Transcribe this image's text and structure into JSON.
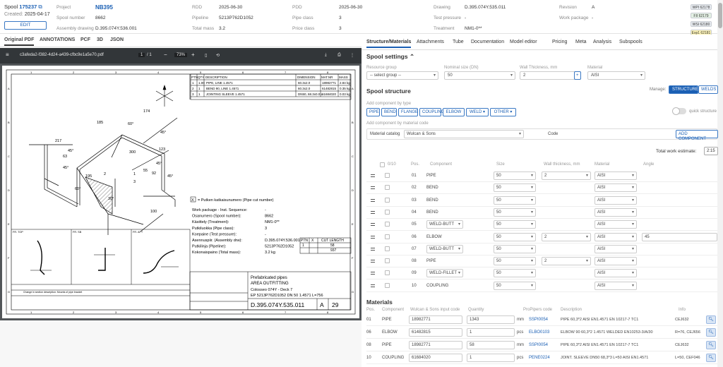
{
  "header": {
    "spool_label": "Spool",
    "spool_id": "175237",
    "created_label": "Created:",
    "created": "2025-04-17",
    "edit": "EDIT",
    "fields": [
      {
        "k": "Project",
        "v": "NB395"
      },
      {
        "k": "Spool number",
        "v": "8662"
      },
      {
        "k": "Assembly drawing",
        "v": "D.395.074Y.536.001"
      },
      {
        "k": "RDD",
        "v": "2025-06-30"
      },
      {
        "k": "Pipeline",
        "v": "5213P762D1052"
      },
      {
        "k": "Total mass",
        "v": "3.2"
      },
      {
        "k": "PDD",
        "v": "2025-06-30"
      },
      {
        "k": "Pipe class",
        "v": "3"
      },
      {
        "k": "Price class",
        "v": "3"
      },
      {
        "k": "Drawing",
        "v": "D.395.074Y.535.011"
      },
      {
        "k": "Test pressure",
        "v": "-"
      },
      {
        "k": "Treatment",
        "v": "NM1-0**"
      },
      {
        "k": "Revision",
        "v": "A"
      },
      {
        "k": "Work package",
        "v": "-"
      }
    ],
    "badges": [
      {
        "t": "WPI 62178",
        "c": "#e9edf2"
      },
      {
        "t": "FII 62179",
        "c": "#e3f0e3"
      },
      {
        "t": "WSI 62180",
        "c": "#e9edf2"
      },
      {
        "t": "Exp1 62181",
        "c": "#fff5b8"
      }
    ]
  },
  "left_tabs": [
    "Original PDF",
    "ANNOTATIONS",
    "PCF",
    "3D",
    "JSON"
  ],
  "pdf": {
    "filename": "c3afeda2-f382-4d24-a439-cfbc9e1a5e70.pdf",
    "page": "1",
    "pages": "/  1",
    "zoom": "73%"
  },
  "drawing": {
    "bom_headers": [
      "PTN",
      "QTY",
      "DESCRIPTION",
      "DIMENSION",
      "MAT.NR",
      "MASS"
    ],
    "bom_rows": [
      [
        "1",
        "1.00",
        "PIPE, LINE 1.4571",
        "60.3x2.0",
        "18982771",
        "2.84 kg"
      ],
      [
        "2",
        "1",
        "BEND 90, LINE 1.4571",
        "60.3x2.0",
        "61482815",
        "0.35 kg"
      ],
      [
        "3",
        "1",
        "JOINTING SLEEVE 1.4571",
        "DN50, 68.3x0.0 L",
        "61684020",
        "0.03 kg"
      ]
    ],
    "dims": [
      "174",
      "60°",
      "45°",
      "217",
      "185",
      "300",
      "123",
      "45°",
      "63",
      "45°",
      "92",
      "55",
      "30°",
      "100",
      "195",
      "45°",
      "2",
      "1",
      "3",
      "60°",
      "45°"
    ],
    "info_cut": "= Putken katkaisunumero (Pipe cut number)",
    "info_x": "X",
    "info_rows": [
      [
        "Work package - Inst. Sequence:",
        "-"
      ],
      [
        "Osanumero  (Spool number):",
        "8662"
      ],
      [
        "Käsittely  (Treatment):",
        "NM1-0**"
      ],
      [
        "Putkiluokka  (Pipe class):",
        "3"
      ],
      [
        "Koepaine  (Test pressure):",
        "-"
      ],
      [
        "Asennuspiir. (Assembly drw):",
        "D.395.074Y.536.001"
      ],
      [
        "Putkilinja  (Pipeline):",
        "5213P762D1052"
      ],
      [
        "Kokonaispaino (Total mass):",
        "3.2 kg"
      ]
    ],
    "cut_table": {
      "h1": "PTN",
      "h2": "X",
      "h3": "CUT LENGTH",
      "r1": [
        "1",
        "",
        "58"
      ],
      "r2": [
        "",
        "",
        "937"
      ]
    },
    "title1": "Prefabricated pipes",
    "title2": "AREA OUTFITTING",
    "title3": "Colosseo 074Y - Deck 7",
    "title4": "EP 5213P762D1052 DN 50 1.4571 L=756",
    "dwgno": "D.395.074Y.535.011",
    "rev": "A",
    "sheet": "29",
    "views": [
      "FR. TOP",
      "FR. SB",
      "FR. AFT"
    ],
    "revnote": "Change in section description: Mounts of pipe bracket",
    "frame_nums": [
      "1",
      "2",
      "3",
      "4",
      "5",
      "6",
      "7",
      "8"
    ],
    "frame_letters": [
      "A",
      "B",
      "C",
      "D",
      "E",
      "F",
      "G"
    ]
  },
  "right_tabs": [
    "Structure/Materials",
    "Attachments",
    "Tube",
    "Documentation",
    "Model editor",
    "Pricing",
    "Meta",
    "Analysis",
    "Subspools"
  ],
  "settings": {
    "title": "Spool settings",
    "rg_label": "Resource group",
    "rg_value": "-- select group --",
    "ns_label": "Nominal size (DN)",
    "ns_value": "50",
    "wt_label": "Wall Thickness, mm",
    "wt_value": "2",
    "plus": "+",
    "mat_label": "Material",
    "mat_value": "AISI"
  },
  "structure": {
    "title": "Spool structure",
    "manage": "Manage:",
    "manage_opts": [
      "STRUCTURE",
      "WELDS"
    ],
    "add_type": "Add component by type",
    "types": [
      "PIPE",
      "BEND",
      "FLANGE",
      "COUPLING",
      "ELBOW",
      "WELD ▾",
      "OTHER ▾"
    ],
    "quick": "quick structure",
    "add_code": "Add component by material code",
    "catalog_label": "Material catalog",
    "catalog": "Wulcan & Sons",
    "code_label": "Code",
    "add_btn": "ADD COMPONENT",
    "total_label": "Total work estimate:",
    "total": "2:15",
    "headers": [
      "0/10",
      "Pos.",
      "Component",
      "Size",
      "Wall thickness, mm",
      "Material",
      "Angle"
    ],
    "rows": [
      {
        "pos": "01",
        "comp": "PIPE",
        "dd": false,
        "size": "50",
        "wt": "2",
        "mat": "AISI",
        "angle": ""
      },
      {
        "pos": "02",
        "comp": "BEND",
        "dd": false,
        "size": "50",
        "wt": "",
        "mat": "AISI",
        "angle": ""
      },
      {
        "pos": "03",
        "comp": "BEND",
        "dd": false,
        "size": "50",
        "wt": "",
        "mat": "AISI",
        "angle": ""
      },
      {
        "pos": "04",
        "comp": "BEND",
        "dd": false,
        "size": "50",
        "wt": "",
        "mat": "AISI",
        "angle": ""
      },
      {
        "pos": "05",
        "comp": "WELD-BUTT",
        "dd": true,
        "size": "50",
        "wt": "",
        "mat": "AISI",
        "angle": ""
      },
      {
        "pos": "06",
        "comp": "ELBOW",
        "dd": false,
        "size": "50",
        "wt": "2",
        "mat": "AISI",
        "angle": "45"
      },
      {
        "pos": "07",
        "comp": "WELD-BUTT",
        "dd": true,
        "size": "50",
        "wt": "",
        "mat": "AISI",
        "angle": ""
      },
      {
        "pos": "08",
        "comp": "PIPE",
        "dd": false,
        "size": "50",
        "wt": "2",
        "mat": "AISI",
        "angle": ""
      },
      {
        "pos": "09",
        "comp": "WELD-FILLET",
        "dd": true,
        "size": "50",
        "wt": "",
        "mat": "AISI",
        "angle": ""
      },
      {
        "pos": "10",
        "comp": "COUPLING",
        "dd": false,
        "size": "50",
        "wt": "",
        "mat": "AISI",
        "angle": ""
      }
    ]
  },
  "materials": {
    "title": "Materials",
    "headers": [
      "Pos.",
      "Component",
      "Wulcan & Sons input code",
      "Quantity",
      "ProPipers code",
      "Description",
      "Info"
    ],
    "rows": [
      {
        "pos": "01",
        "comp": "PIPE",
        "code": "18982771",
        "qty": "1343",
        "unit": "mm",
        "pp": "SSPI0054",
        "desc": "PIPE 60,3*2 AISI EN1.4571 EN 10217-7 TC1",
        "info": "CEJ632"
      },
      {
        "pos": "06",
        "comp": "ELBOW",
        "code": "61482815",
        "qty": "1",
        "unit": "pcs",
        "pp": "ELBO0103",
        "desc": "ELBOW 90 60,3*2 1.4571 WELDED EN10253-3/A/30",
        "info": "R=76, CEJ656"
      },
      {
        "pos": "08",
        "comp": "PIPE",
        "code": "18982771",
        "qty": "58",
        "unit": "mm",
        "pp": "SSPI0054",
        "desc": "PIPE 60,3*2 AISI EN1.4571 EN 10217-7 TC1",
        "info": "CEJ632"
      },
      {
        "pos": "10",
        "comp": "COUPLING",
        "code": "61684020",
        "qty": "1",
        "unit": "pcs",
        "pp": "PENE0224",
        "desc": "JOINT. SLEEVE DN50 68,3*3 L=50 AISI EN1.4571",
        "info": "L=50, CEF046"
      }
    ]
  },
  "colors": {
    "accent": "#1a5fb4",
    "pdf_toolbar": "#323639"
  }
}
